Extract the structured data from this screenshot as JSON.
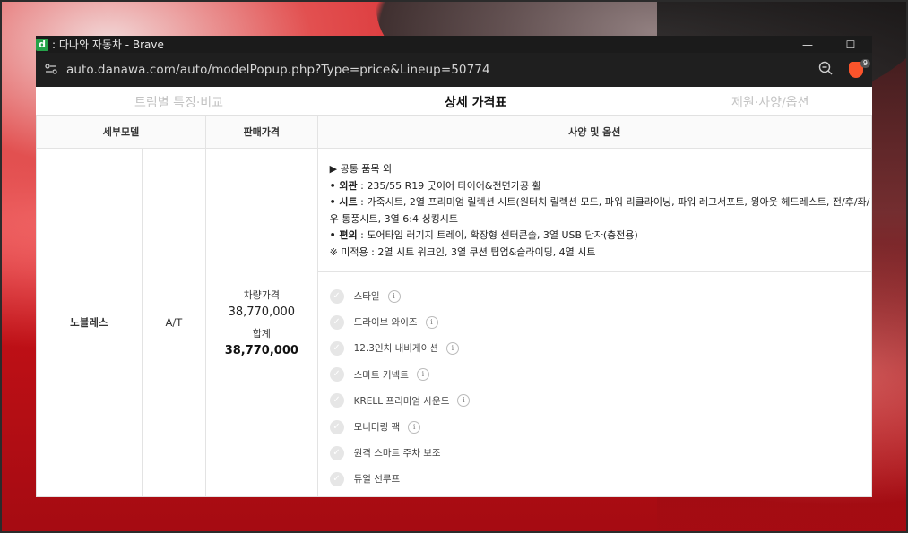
{
  "window": {
    "favicon": "d",
    "title": ": 다나와 자동차 - Brave",
    "minimize": "—",
    "maximize": "☐",
    "url": "auto.danawa.com/auto/modelPopup.php?Type=price&Lineup=50774",
    "shield_count": "9"
  },
  "tabs": {
    "left": "트림별 특징·비교",
    "center": "상세 가격표",
    "right": "제원·사양/옵션"
  },
  "table": {
    "headers": {
      "model": "세부모델",
      "price": "판매가격",
      "spec": "사양 및 옵션"
    },
    "row": {
      "model": "노블레스",
      "transmission": "A/T",
      "price_label": "차량가격",
      "price_value": "38,770,000",
      "total_label": "합계",
      "total_value": "38,770,000",
      "spec_heading": "▶ 공통 품목 외",
      "spec_lines": {
        "l1_label": "• 외관",
        "l1_text": " : 235/55 R19 굿이어 타이어&전면가공 휠",
        "l2_label": "• 시트",
        "l2_text": " : 가죽시트, 2열 프리미엄 릴렉션 시트(원터치 릴렉션 모드, 파워 리클라이닝, 파워 레그서포트, 윙아웃 헤드레스트, 전/후/좌/우 통풍시트, 3열 6:4 싱킹시트",
        "l3_label": "• 편의",
        "l3_text": " : 도어타입 러기지 트레이, 확장형 센터콘솔, 3열 USB 단자(충전용)",
        "l4": "※ 미적용 : 2열 시트 워크인, 3열 쿠션 팁업&슬라이딩, 4열 시트"
      },
      "options": [
        "스타일",
        "드라이브 와이즈",
        "12.3인치 내비게이션",
        "스마트 커넥트",
        "KRELL 프리미엄 사운드",
        "모니터링 팩",
        "원격 스마트 주차 보조",
        "듀얼 선루프"
      ]
    }
  },
  "colors": {
    "accent_red": "#c9171f",
    "brave_orange": "#fb542b"
  }
}
